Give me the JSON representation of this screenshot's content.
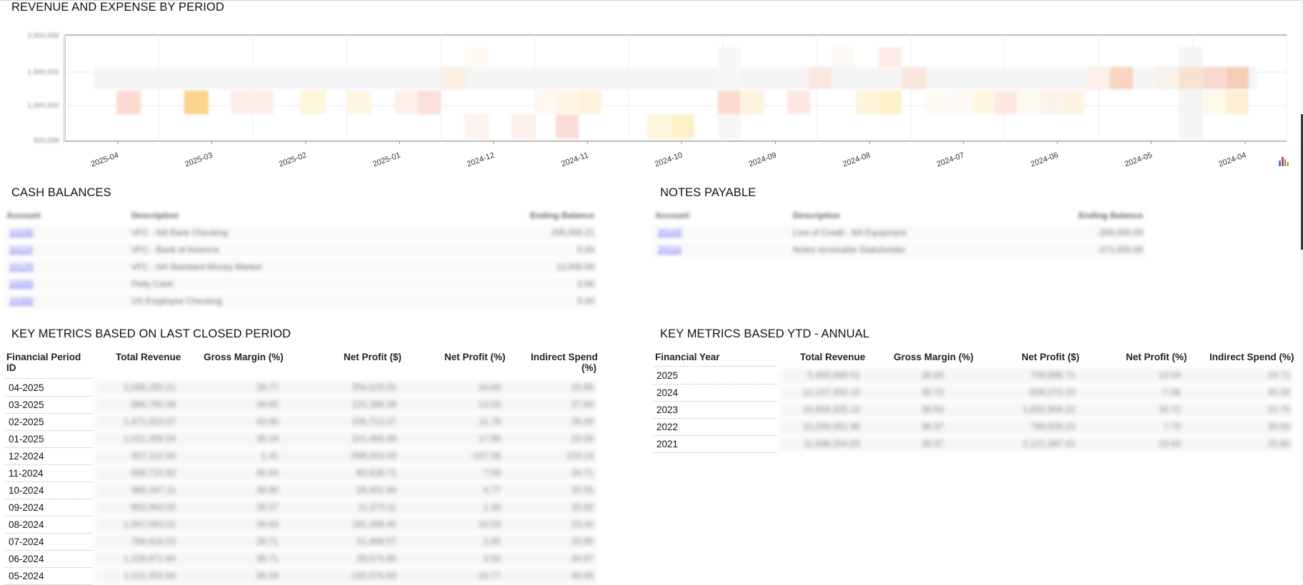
{
  "revenue_expense": {
    "title": "REVENUE AND EXPENSE BY PERIOD",
    "y_ticks": [
      "2,500,000",
      "1,500,000",
      "1,000,000",
      "500,000"
    ],
    "x_ticks": [
      "2025-04",
      "2025-03",
      "2025-02",
      "2025-01",
      "2024-12",
      "2024-11",
      "2024-10",
      "2024-09",
      "2024-08",
      "2024-07",
      "2024-06",
      "2024-05",
      "2024-04"
    ],
    "chart_icon": "bar-chart-icon"
  },
  "cash_balances": {
    "title": "CASH BALANCES",
    "headers": [
      "Account",
      "Description",
      "Ending Balance"
    ],
    "rows": [
      {
        "account": "10100",
        "description": "VFC - NA Bank Checking",
        "balance": "205,000.21"
      },
      {
        "account": "10110",
        "description": "VFC - Bank of America",
        "balance": "0.00"
      },
      {
        "account": "10120",
        "description": "VFC - NA Standard Money Market",
        "balance": "12,000.00"
      },
      {
        "account": "10200",
        "description": "Petty Cash",
        "balance": "0.00"
      },
      {
        "account": "10300",
        "description": "US Employee Checking",
        "balance": "0.00"
      }
    ]
  },
  "notes_payable": {
    "title": "NOTES PAYABLE",
    "headers": [
      "Account",
      "Description",
      "Ending Balance"
    ],
    "rows": [
      {
        "account": "20100",
        "description": "Line of Credit - NA Equipment",
        "balance": "-200,000.00"
      },
      {
        "account": "20110",
        "description": "Notes receivable-Stakeholder",
        "balance": "-271,000.00"
      }
    ]
  },
  "metrics_period": {
    "title": "KEY METRICS BASED ON LAST CLOSED PERIOD",
    "headers": {
      "id_line1": "Financial Period",
      "id_line2": "ID",
      "revenue": "Total Revenue",
      "gross_margin": "Gross Margin (%)",
      "net_profit_amt": "Net Profit ($)",
      "net_profit_pct": "Net Profit (%)",
      "indirect_line1": "Indirect Spend",
      "indirect_line2": "(%)"
    },
    "rows": [
      {
        "id": "04-2025",
        "revenue": "2,086,293.21",
        "gm": "39.77",
        "np": "356,629.55",
        "npp": "16.84",
        "ind": "20.86"
      },
      {
        "id": "03-2025",
        "revenue": "886,755.09",
        "gm": "39.85",
        "np": "125,388.08",
        "npp": "14.63",
        "ind": "27.83"
      },
      {
        "id": "02-2025",
        "revenue": "1,471,323.07",
        "gm": "40.90",
        "np": "156,712.27",
        "npp": "11.79",
        "ind": "28.69"
      },
      {
        "id": "01-2025",
        "revenue": "1,021,358.54",
        "gm": "38.24",
        "np": "101,466.08",
        "npp": "17.89",
        "ind": "23.56"
      },
      {
        "id": "12-2024",
        "revenue": "657,112.00",
        "gm": "1.41",
        "np": "-998,003.43",
        "npp": "-107.56",
        "ind": "153.14"
      },
      {
        "id": "11-2024",
        "revenue": "688,715.82",
        "gm": "40.84",
        "np": "80,628.71",
        "npp": "7.59",
        "ind": "34.71"
      },
      {
        "id": "10-2024",
        "revenue": "980,347.11",
        "gm": "39.80",
        "np": "28,451.94",
        "npp": "4.77",
        "ind": "32.55"
      },
      {
        "id": "09-2024",
        "revenue": "850,963.00",
        "gm": "38.57",
        "np": "11,373.11",
        "npp": "1.34",
        "ind": "33.82"
      },
      {
        "id": "08-2024",
        "revenue": "1,097,063.01",
        "gm": "39.63",
        "np": "181,398.45",
        "npp": "16.53",
        "ind": "23.42"
      },
      {
        "id": "07-2024",
        "revenue": "766,918.53",
        "gm": "39.71",
        "np": "21,868.57",
        "npp": "2.85",
        "ind": "33.85"
      },
      {
        "id": "06-2024",
        "revenue": "1,108,971.84",
        "gm": "38.71",
        "np": "39,674.80",
        "npp": "3.50",
        "ind": "34.87"
      },
      {
        "id": "05-2024",
        "revenue": "1,101,303.84",
        "gm": "36.58",
        "np": "-195,576.83",
        "npp": "-19.77",
        "ind": "49.66"
      }
    ]
  },
  "metrics_annual": {
    "title": "KEY METRICS BASED YTD - ANNUAL",
    "headers": {
      "year": "Financial Year",
      "revenue": "Total Revenue",
      "gross_margin": "Gross Margin (%)",
      "net_profit_amt": "Net Profit ($)",
      "net_profit_pct": "Net Profit (%)",
      "indirect": "Indirect Spend (%)"
    },
    "rows": [
      {
        "year": "2025",
        "revenue": "5,465,669.51",
        "gm": "39.64",
        "np": "739,888.71",
        "npp": "13.54",
        "ind": "24.71"
      },
      {
        "year": "2024",
        "revenue": "12,107,350.10",
        "gm": "30.72",
        "np": "-938,272.10",
        "npp": "-7.66",
        "ind": "45.34"
      },
      {
        "year": "2023",
        "revenue": "10,958,325.12",
        "gm": "39.83",
        "np": "1,832,908.22",
        "npp": "16.72",
        "ind": "22.75"
      },
      {
        "year": "2022",
        "revenue": "10,266,681.98",
        "gm": "38.37",
        "np": "789,828.23",
        "npp": "7.70",
        "ind": "30.60"
      },
      {
        "year": "2021",
        "revenue": "11,938,354.83",
        "gm": "38.57",
        "np": "2,121,397.41",
        "npp": "19.63",
        "ind": "25.82"
      }
    ]
  }
}
